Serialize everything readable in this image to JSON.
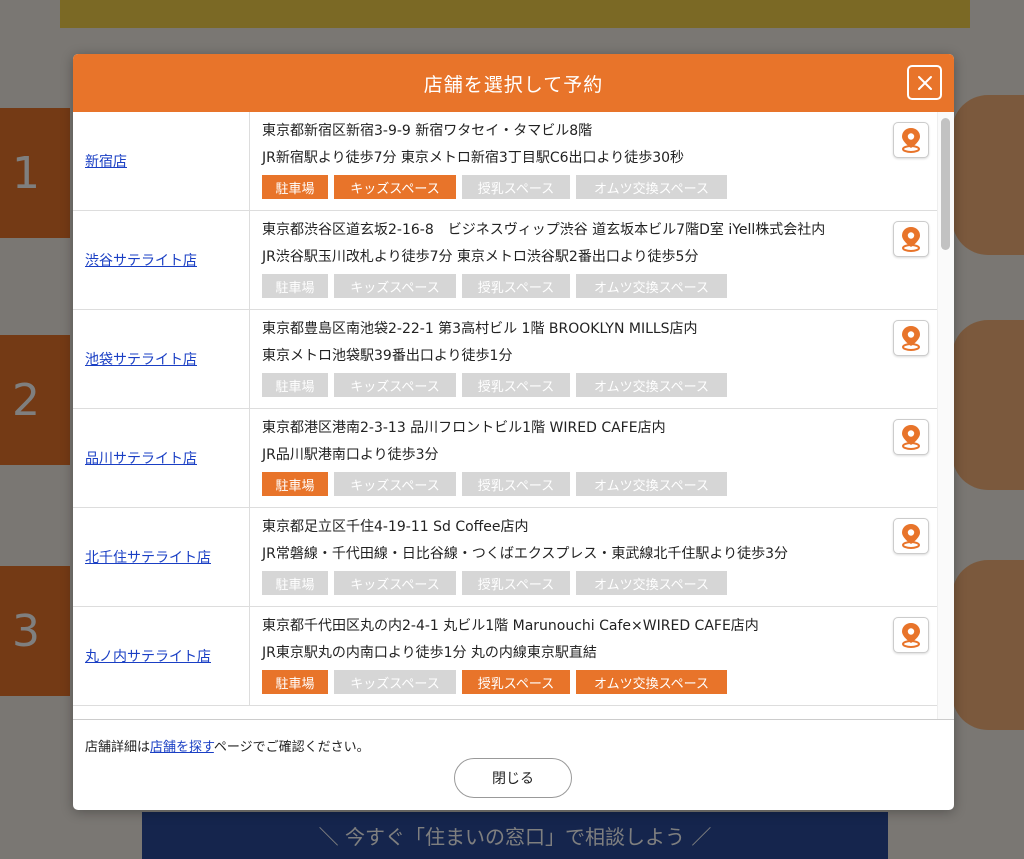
{
  "background": {
    "steps": [
      "1",
      "2",
      "3"
    ],
    "bottom_banner": "＼ 今すぐ「住まいの窓口」で相談しよう ／"
  },
  "modal": {
    "title": "店舗を選択して予約",
    "tag_labels": [
      "駐車場",
      "キッズスペース",
      "授乳スペース",
      "オムツ交換スペース"
    ],
    "stores": [
      {
        "name": "新宿店",
        "address": "東京都新宿区新宿3-9-9 新宿ワタセイ・タマビル8階",
        "access": "JR新宿駅より徒歩7分 東京メトロ新宿3丁目駅C6出口より徒歩30秒",
        "tags_active": [
          true,
          true,
          false,
          false
        ]
      },
      {
        "name": "渋谷サテライト店",
        "address": "東京都渋谷区道玄坂2-16-8　ビジネスヴィップ渋谷 道玄坂本ビル7階D室 iYell株式会社内",
        "access": "JR渋谷駅玉川改札より徒歩7分 東京メトロ渋谷駅2番出口より徒歩5分",
        "tags_active": [
          false,
          false,
          false,
          false
        ]
      },
      {
        "name": "池袋サテライト店",
        "address": "東京都豊島区南池袋2-22-1 第3高村ビル 1階 BROOKLYN MILLS店内",
        "access": "東京メトロ池袋駅39番出口より徒歩1分",
        "tags_active": [
          false,
          false,
          false,
          false
        ]
      },
      {
        "name": "品川サテライト店",
        "address": "東京都港区港南2-3-13 品川フロントビル1階 WIRED CAFE店内",
        "access": "JR品川駅港南口より徒歩3分",
        "tags_active": [
          true,
          false,
          false,
          false
        ]
      },
      {
        "name": "北千住サテライト店",
        "address": "東京都足立区千住4-19-11 Sd Coffee店内",
        "access": "JR常磐線・千代田線・日比谷線・つくばエクスプレス・東武線北千住駅より徒歩3分",
        "tags_active": [
          false,
          false,
          false,
          false
        ]
      },
      {
        "name": "丸ノ内サテライト店",
        "address": "東京都千代田区丸の内2-4-1 丸ビル1階 Marunouchi Cafe×WIRED CAFE店内",
        "access": "JR東京駅丸の内南口より徒歩1分 丸の内線東京駅直結",
        "tags_active": [
          true,
          false,
          true,
          true
        ]
      }
    ],
    "footer": {
      "note_prefix": "店舗詳細は",
      "note_link": "店舗を探す",
      "note_suffix": "ページでご確認ください。",
      "close_label": "閉じる"
    }
  },
  "icons": {
    "close": "close-icon",
    "map": "map-pin-icon"
  },
  "colors": {
    "accent": "#e8742a",
    "tag_inactive": "#d6d6d6",
    "link": "#1a3fc4"
  }
}
